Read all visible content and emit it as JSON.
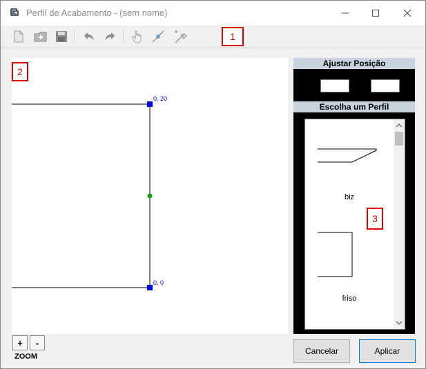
{
  "window": {
    "title": "Perfil de Acabamento - (sem nome)"
  },
  "markers": {
    "m1": "1",
    "m2": "2",
    "m3": "3"
  },
  "toolbar": {
    "icons": [
      "new-icon",
      "open-icon",
      "save-icon",
      "undo-icon",
      "redo-icon",
      "hand-icon",
      "pick-point-icon",
      "clear-icon"
    ]
  },
  "canvas": {
    "point_top_label": "0, 20",
    "point_bottom_label": "0, 0",
    "line_color": "#000000",
    "point_color": "#0000ff",
    "mid_point_color": "#1a9a1a"
  },
  "zoom": {
    "plus": "+",
    "minus": "-",
    "label": "ZOOM"
  },
  "panel": {
    "adjust_header": "Ajustar Posição",
    "pos_x_value": "",
    "pos_y_value": "",
    "choose_header": "Escolha um Perfil",
    "profiles": [
      {
        "name": "biz"
      },
      {
        "name": "friso"
      }
    ]
  },
  "buttons": {
    "cancel": "Cancelar",
    "apply": "Aplicar"
  }
}
